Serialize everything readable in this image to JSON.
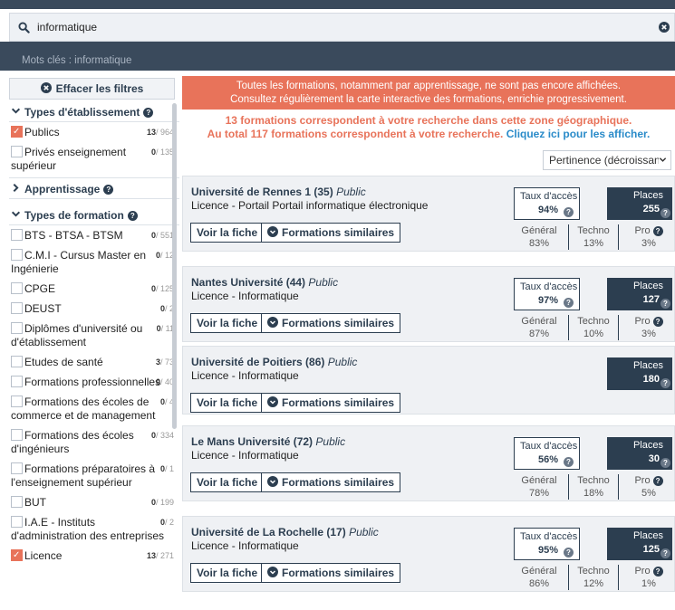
{
  "search": {
    "value": "informatique",
    "keywords_label": "Mots clés : informatique"
  },
  "sidebar": {
    "reset_label": "Effacer les filtres",
    "sections": {
      "etab": {
        "title": "Types d'établissement"
      },
      "appr": {
        "title": "Apprentissage"
      },
      "form": {
        "title": "Types de formation"
      }
    },
    "etab_items": [
      {
        "label": "Publics",
        "count": "13",
        "total": "/ 964",
        "checked": true
      },
      {
        "label": "Privés enseignement supérieur",
        "count": "0",
        "total": "/ 135",
        "checked": false
      }
    ],
    "form_items": [
      {
        "label": "BTS - BTSA - BTSM",
        "count": "0",
        "total": "/ 551"
      },
      {
        "label": "C.M.I - Cursus Master en Ingénierie",
        "count": "0",
        "total": "/ 12"
      },
      {
        "label": "CPGE",
        "count": "0",
        "total": "/ 125"
      },
      {
        "label": "DEUST",
        "count": "0",
        "total": "/ 2"
      },
      {
        "label": "Diplômes d'université ou d'établissement",
        "count": "0",
        "total": "/ 11"
      },
      {
        "label": "Etudes de santé",
        "count": "3",
        "total": "/ 73"
      },
      {
        "label": "Formations professionnelles",
        "count": "0",
        "total": "/ 40"
      },
      {
        "label": "Formations des écoles de commerce et de management",
        "count": "0",
        "total": "/ 4"
      },
      {
        "label": "Formations des écoles d'ingénieurs",
        "count": "0",
        "total": "/ 334"
      },
      {
        "label": "Formations préparatoires à l'enseignement supérieur",
        "count": "0",
        "total": "/ 1"
      },
      {
        "label": "BUT",
        "count": "0",
        "total": "/ 199"
      },
      {
        "label": "I.A.E - Instituts d'administration des entreprises",
        "count": "0",
        "total": "/ 2"
      },
      {
        "label": "Licence",
        "count": "13",
        "total": "/ 271",
        "checked": true
      }
    ]
  },
  "alert": {
    "line1": "Toutes les formations, notamment par apprentissage, ne sont pas encore affichées.",
    "line2": "Consultez régulièrement la carte interactive des formations, enrichie progressivement."
  },
  "summary": {
    "line1": "13 formations correspondent à votre recherche dans cette zone géographique.",
    "line2_text": "Au total 117 formations correspondent à votre recherche.",
    "line2_link": "Cliquez ici pour les afficher."
  },
  "sort": {
    "value": "Pertinence (décroissant)"
  },
  "card_labels": {
    "voir": "Voir la fiche",
    "similaires": "Formations similaires",
    "taux": "Taux d'accès",
    "places": "Places",
    "general": "Général",
    "techno": "Techno",
    "pro": "Pro",
    "public": "Public"
  },
  "results": [
    {
      "name": "Université de Rennes 1 (35)",
      "program": "Licence - Portail Portail informatique électronique",
      "taux": "94%",
      "places": "255",
      "general": "83%",
      "techno": "13%",
      "pro": "3%"
    },
    {
      "name": "Nantes Université (44)",
      "program": "Licence - Informatique",
      "taux": "97%",
      "places": "127",
      "general": "87%",
      "techno": "10%",
      "pro": "3%"
    },
    {
      "name": "Université de Poitiers (86)",
      "program": "Licence - Informatique",
      "taux": "",
      "places": "180",
      "general": "",
      "techno": "",
      "pro": ""
    },
    {
      "name": "Le Mans Université (72)",
      "program": "Licence - Informatique",
      "taux": "56%",
      "places": "30",
      "general": "78%",
      "techno": "18%",
      "pro": "5%"
    },
    {
      "name": "Université de La Rochelle (17)",
      "program": "Licence - Informatique",
      "taux": "95%",
      "places": "125",
      "general": "86%",
      "techno": "12%",
      "pro": "1%"
    }
  ],
  "colors": {
    "accent": "#e8735a",
    "navy": "#2c3e50",
    "link": "#2a8bc9",
    "header": "#3a4a5c"
  }
}
